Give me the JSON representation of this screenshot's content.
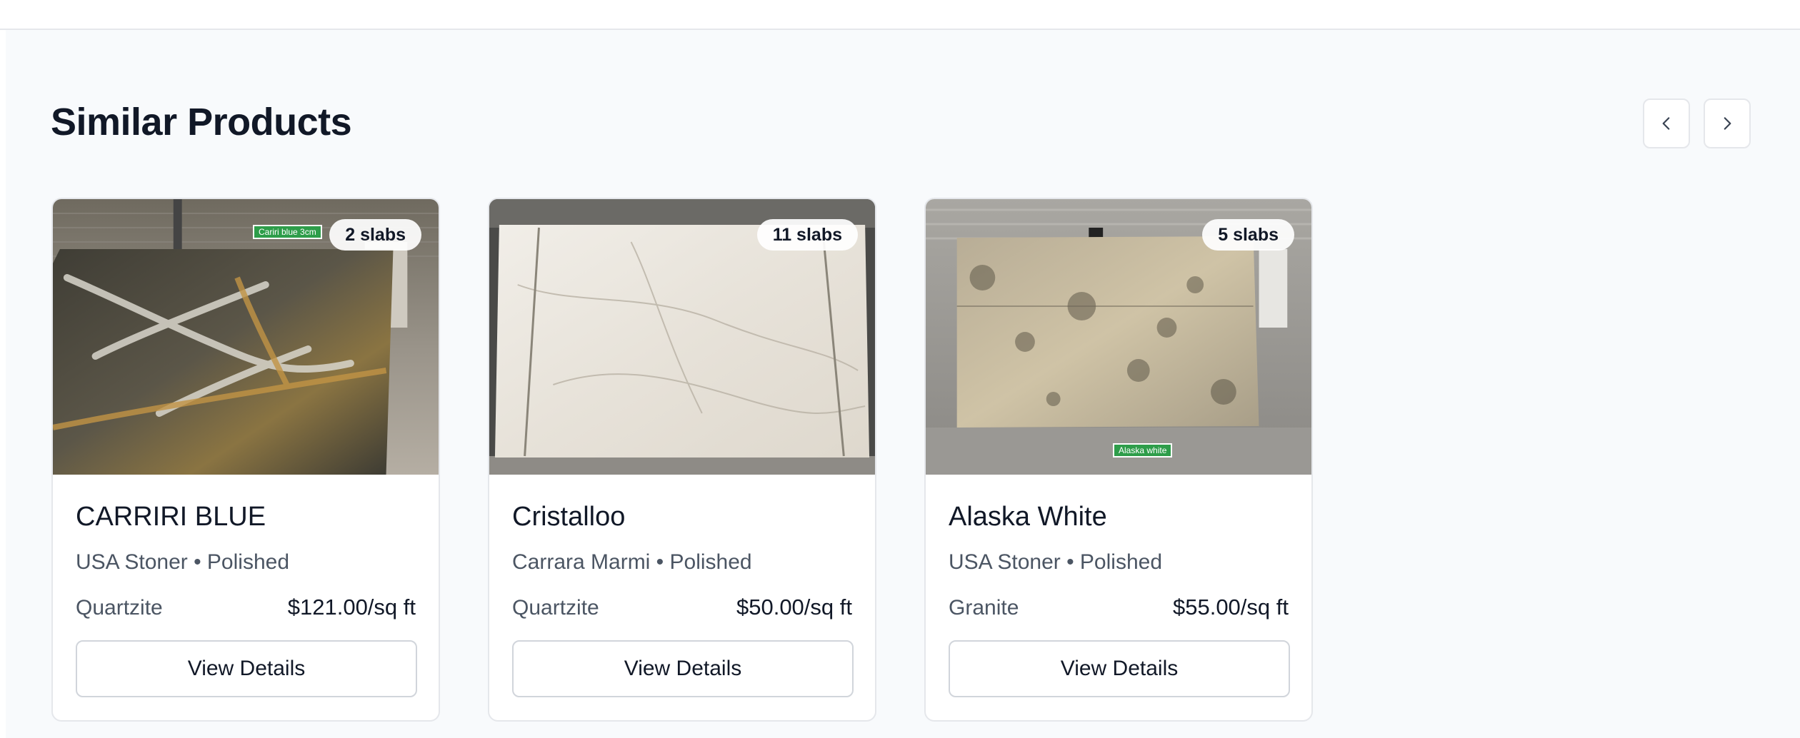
{
  "header": {
    "title": "Similar Products"
  },
  "nav": {
    "prev_icon": "chevron-left-icon",
    "next_icon": "chevron-right-icon"
  },
  "products": [
    {
      "name": "CARRIRI BLUE",
      "supplier_finish": "USA Stoner • Polished",
      "material": "Quartzite",
      "price": "$121.00/sq ft",
      "slabs": "2 slabs",
      "image_tag": "Cariri blue 3cm",
      "button_label": "View Details"
    },
    {
      "name": "Cristalloo",
      "supplier_finish": "Carrara Marmi • Polished",
      "material": "Quartzite",
      "price": "$50.00/sq ft",
      "slabs": "11 slabs",
      "button_label": "View Details"
    },
    {
      "name": "Alaska White",
      "supplier_finish": "USA Stoner • Polished",
      "material": "Granite",
      "price": "$55.00/sq ft",
      "slabs": "5 slabs",
      "image_tag": "Alaska white",
      "button_label": "View Details"
    }
  ],
  "colors": {
    "section_bg": "#f8fafc",
    "tag_green": "#2e9d4a",
    "border": "#e5e7eb"
  }
}
